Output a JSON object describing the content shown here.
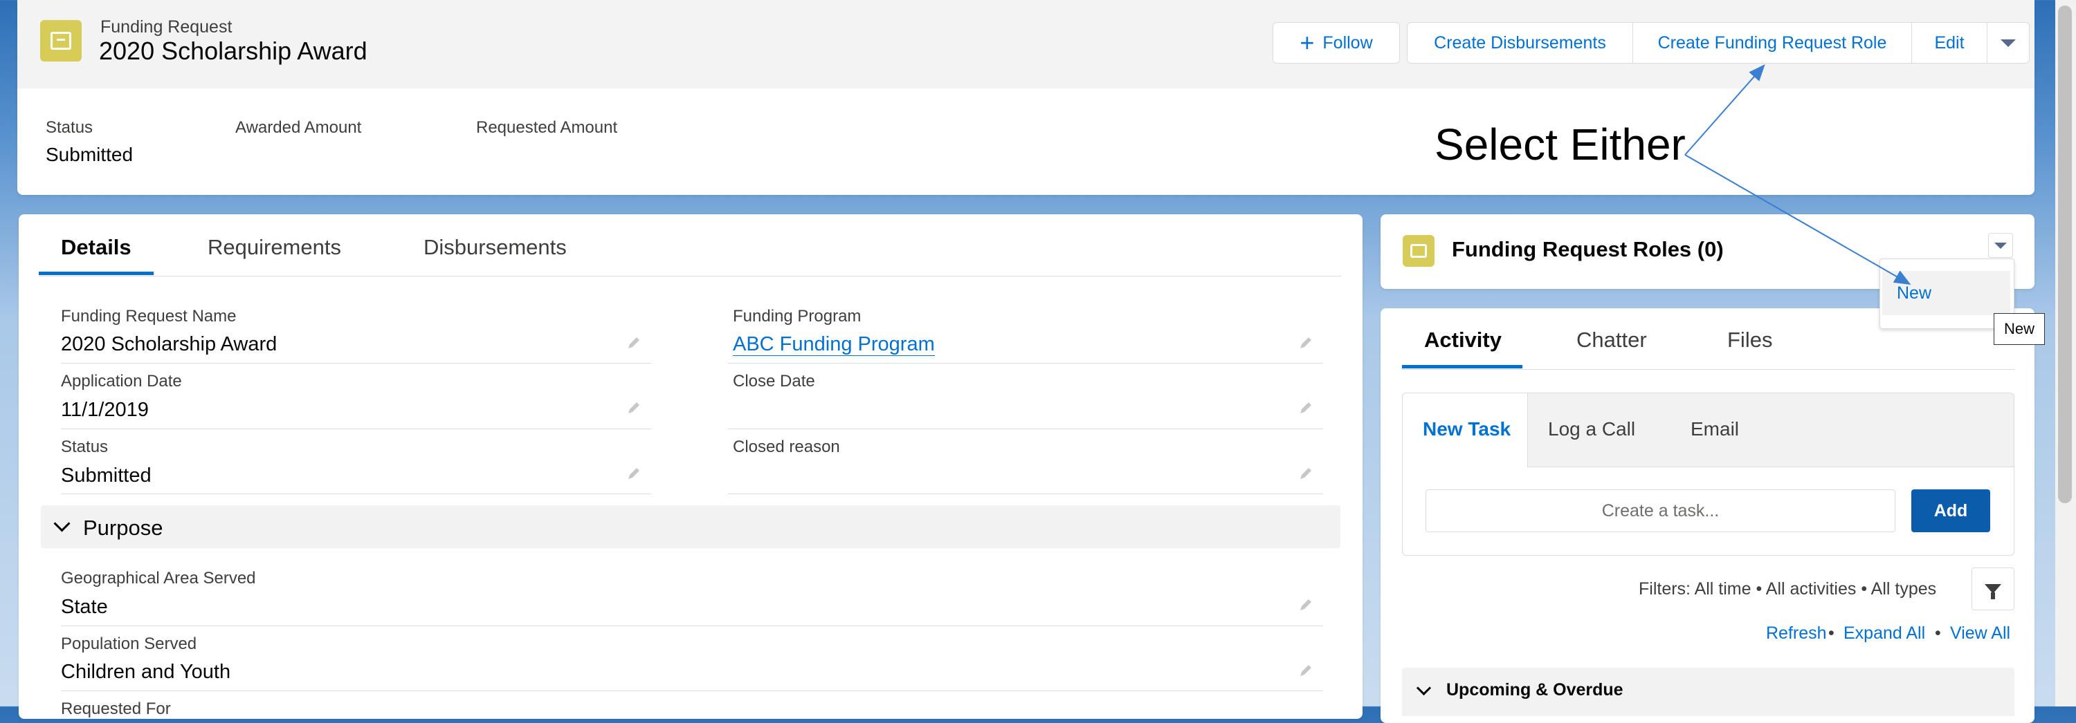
{
  "header": {
    "object_type": "Funding Request",
    "record_title": "2020 Scholarship Award",
    "actions": {
      "follow": "Follow",
      "create_disbursements": "Create Disbursements",
      "create_role": "Create Funding Request Role",
      "edit": "Edit"
    },
    "highlights": [
      {
        "label": "Status",
        "value": "Submitted"
      },
      {
        "label": "Awarded Amount",
        "value": ""
      },
      {
        "label": "Requested Amount",
        "value": ""
      }
    ]
  },
  "annotation": {
    "text": "Select Either"
  },
  "details": {
    "tabs": [
      "Details",
      "Requirements",
      "Disbursements"
    ],
    "fields": {
      "name": {
        "label": "Funding Request Name",
        "value": "2020 Scholarship Award"
      },
      "program": {
        "label": "Funding Program",
        "value": "ABC Funding Program"
      },
      "app_date": {
        "label": "Application Date",
        "value": "11/1/2019"
      },
      "close_date": {
        "label": "Close Date",
        "value": ""
      },
      "status": {
        "label": "Status",
        "value": "Submitted"
      },
      "closed_reason": {
        "label": "Closed reason",
        "value": ""
      }
    },
    "purpose_section": {
      "title": "Purpose",
      "geo": {
        "label": "Geographical Area Served",
        "value": "State"
      },
      "population": {
        "label": "Population Served",
        "value": "Children and Youth"
      },
      "next_label": "Requested For"
    }
  },
  "related": {
    "title": "Funding Request Roles (0)",
    "menu_item": "New",
    "tooltip": "New"
  },
  "activity": {
    "tabs": [
      "Activity",
      "Chatter",
      "Files"
    ],
    "composer_tabs": [
      "New Task",
      "Log a Call",
      "Email"
    ],
    "task_placeholder": "Create a task...",
    "add_label": "Add",
    "filters": "Filters: All time • All activities • All types",
    "links": {
      "refresh": "Refresh",
      "expand": "Expand All",
      "view": "View All"
    },
    "upcoming": "Upcoming & Overdue"
  },
  "colors": {
    "accent": "#0070d2",
    "object_icon": "#d7cc58",
    "add_button": "#0b5cab"
  }
}
